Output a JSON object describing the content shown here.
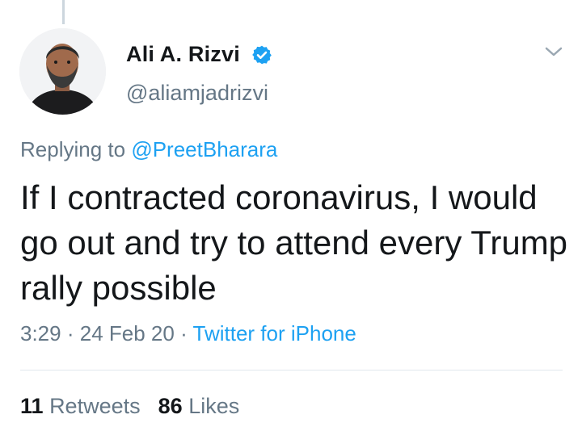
{
  "author": {
    "display_name": "Ali A. Rizvi",
    "handle": "@aliamjadrizvi",
    "verified": true,
    "avatar_icon": "profile-photo"
  },
  "reply": {
    "prefix": "Replying to",
    "mention": "@PreetBharara"
  },
  "tweet": {
    "text": "If I contracted coronavirus, I would go out and try to attend every Trump rally possible"
  },
  "meta": {
    "time": "3:29",
    "separator": "·",
    "date": "24 Feb 20",
    "source": "Twitter for iPhone"
  },
  "stats": {
    "retweets_count": "11",
    "retweets_label": "Retweets",
    "likes_count": "86",
    "likes_label": "Likes"
  },
  "colors": {
    "link": "#1da1f2",
    "secondary_text": "#657786",
    "primary_text": "#14171a",
    "divider": "#e1e8ed"
  },
  "icons": {
    "verified": "verified-badge-icon",
    "menu": "chevron-down-icon"
  }
}
